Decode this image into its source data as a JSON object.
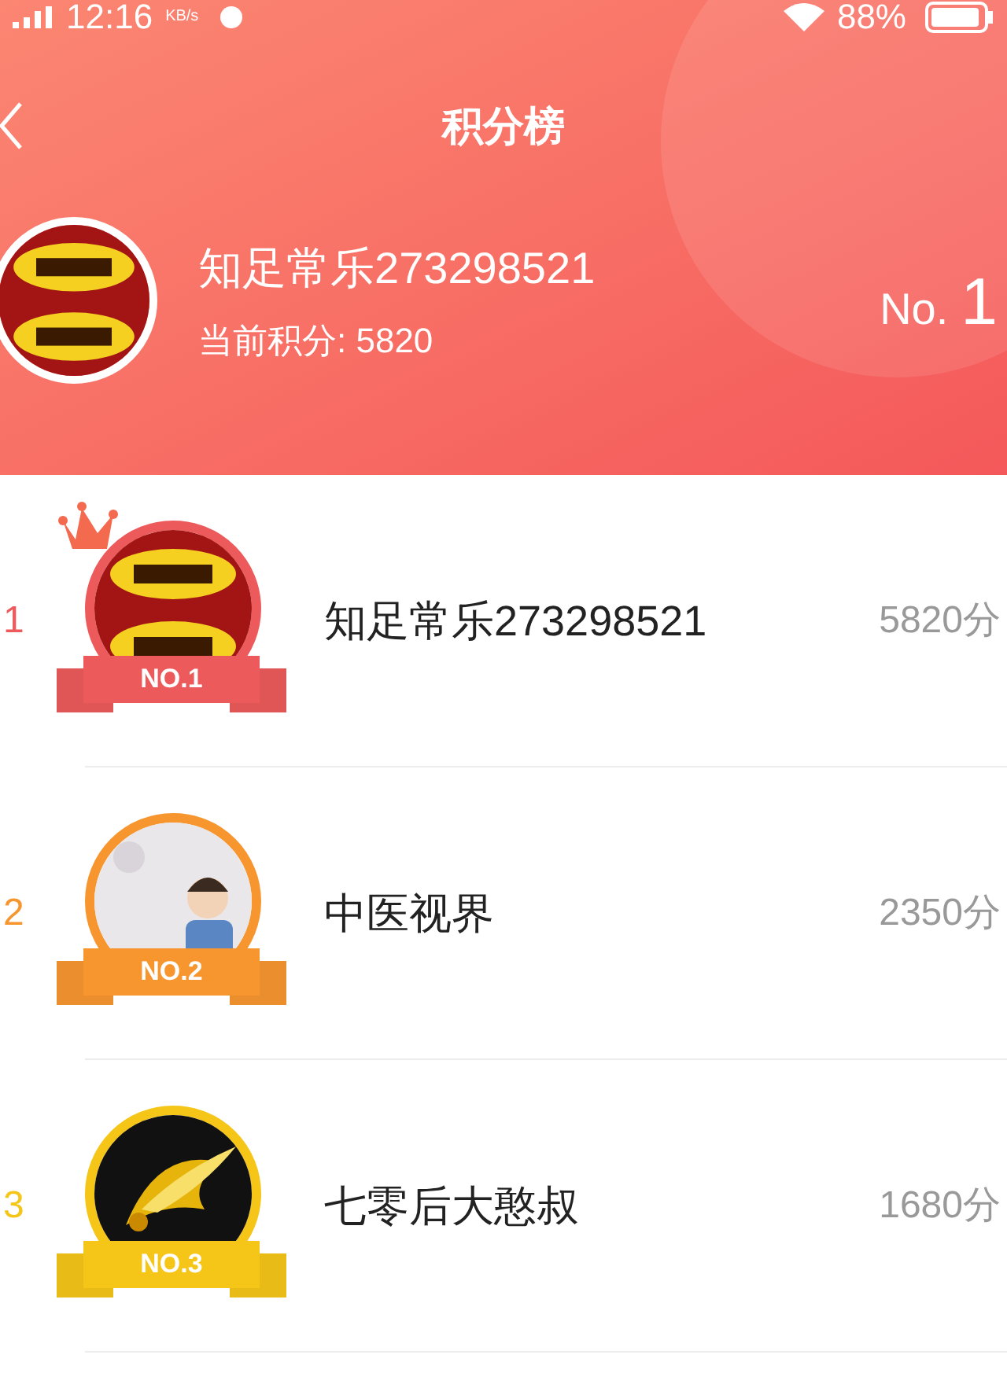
{
  "status_bar": {
    "time": "12:16",
    "speed_unit": "KB/s",
    "battery": "88%"
  },
  "header": {
    "title": "积分榜"
  },
  "me": {
    "name": "知足常乐273298521",
    "points": "当前积分: 5820",
    "rank_prefix": "No.",
    "rank": "1"
  },
  "ranking": [
    {
      "rank": "1",
      "name": "知足常乐273298521",
      "score": "5820分",
      "badge": "NO.1",
      "color": "#ec5a5c",
      "crowned": true
    },
    {
      "rank": "2",
      "name": "中医视界",
      "score": "2350分",
      "badge": "NO.2",
      "color": "#f7962f",
      "crowned": false
    },
    {
      "rank": "3",
      "name": "七零后大憨叔",
      "score": "1680分",
      "badge": "NO.3",
      "color": "#f5c518",
      "crowned": false
    }
  ]
}
